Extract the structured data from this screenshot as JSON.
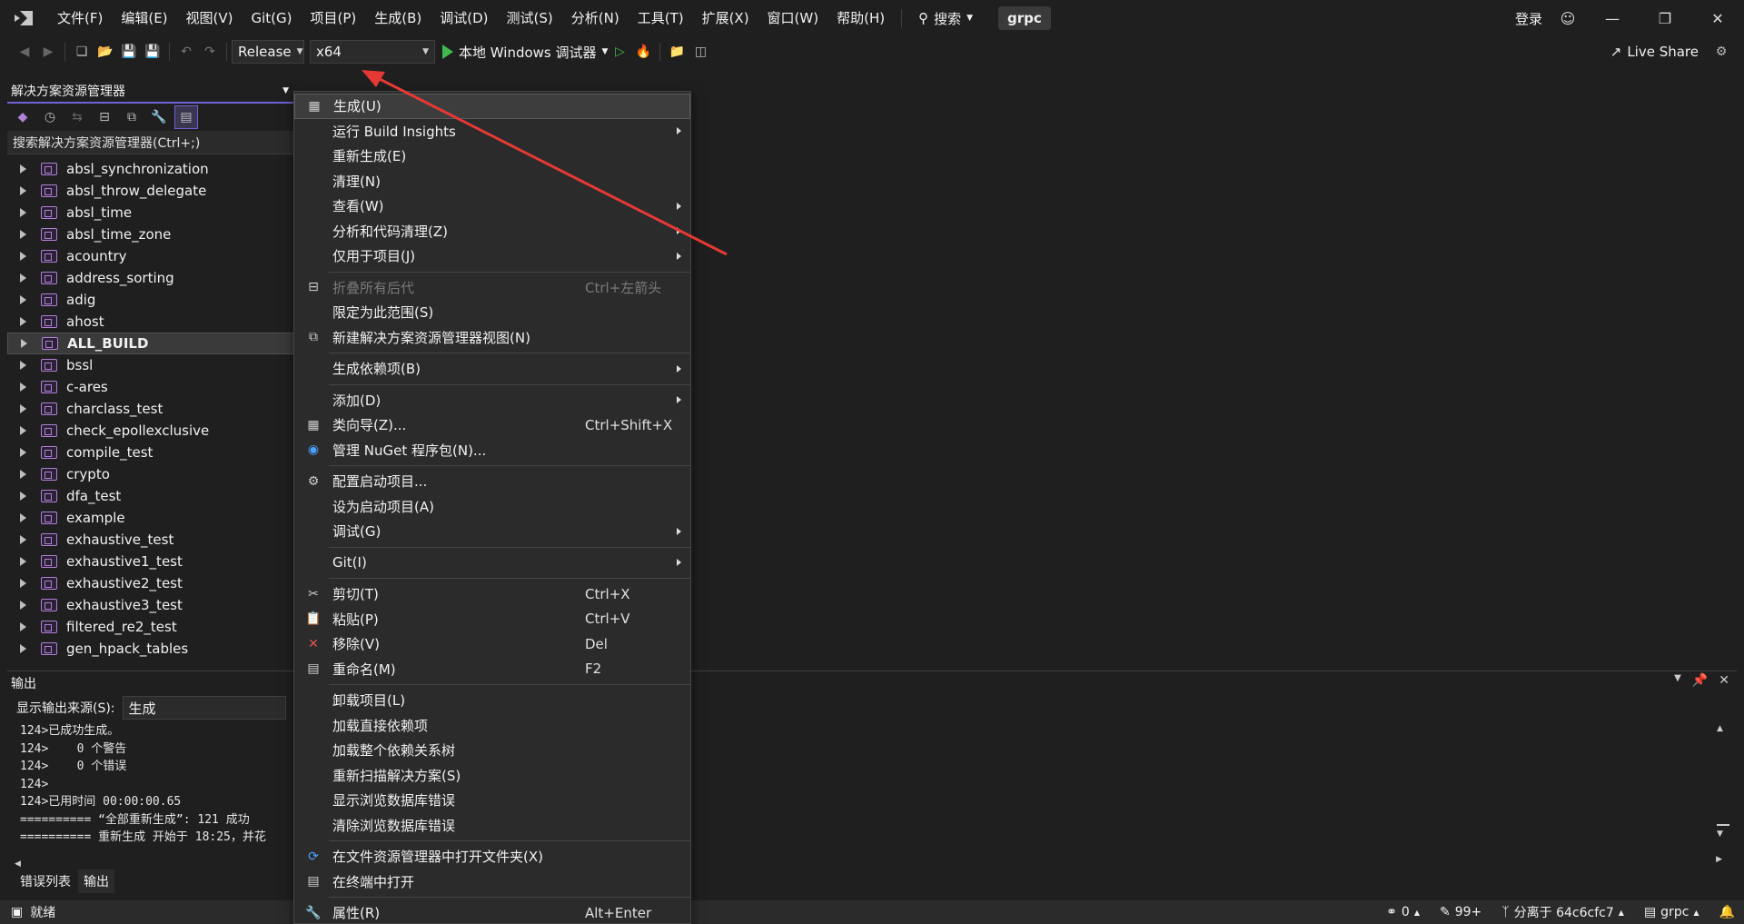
{
  "menubar": {
    "items": [
      "文件(F)",
      "编辑(E)",
      "视图(V)",
      "Git(G)",
      "项目(P)",
      "生成(B)",
      "调试(D)",
      "测试(S)",
      "分析(N)",
      "工具(T)",
      "扩展(X)",
      "窗口(W)",
      "帮助(H)"
    ],
    "search_label": "搜索",
    "project_name": "grpc",
    "login_label": "登录"
  },
  "toolbar": {
    "configuration": "Release",
    "platform": "x64",
    "run_label": "本地 Windows 调试器",
    "live_share": "Live Share"
  },
  "solution_explorer": {
    "title": "解决方案资源管理器",
    "search_placeholder": "搜索解决方案资源管理器(Ctrl+;)",
    "items": [
      "absl_synchronization",
      "absl_throw_delegate",
      "absl_time",
      "absl_time_zone",
      "acountry",
      "address_sorting",
      "adig",
      "ahost",
      "ALL_BUILD",
      "bssl",
      "c-ares",
      "charclass_test",
      "check_epollexclusive",
      "compile_test",
      "crypto",
      "dfa_test",
      "example",
      "exhaustive_test",
      "exhaustive1_test",
      "exhaustive2_test",
      "exhaustive3_test",
      "filtered_re2_test",
      "gen_hpack_tables"
    ],
    "selected": "ALL_BUILD"
  },
  "output": {
    "title": "输出",
    "source_label": "显示输出来源(S):",
    "source_value": "生成",
    "lines": [
      "124>已成功生成。",
      "124>    0 个警告",
      "124>    0 个错误",
      "124>",
      "124>已用时间 00:00:00.65",
      "========== “全部重新生成”: 121 成功",
      "========== 重新生成 开始于 18:25，并花"
    ],
    "tabs": [
      "错误列表",
      "输出"
    ]
  },
  "statusbar": {
    "ready": "就绪",
    "errors": "0",
    "changes": "99+",
    "branch": "分离于 64c6cfc7",
    "repo": "grpc"
  },
  "context_menu": {
    "items": [
      {
        "label": "生成(U)",
        "icon": "build-icon",
        "highlight": true
      },
      {
        "label": "运行 Build Insights",
        "submenu": true
      },
      {
        "label": "重新生成(E)"
      },
      {
        "label": "清理(N)"
      },
      {
        "label": "查看(W)",
        "submenu": true
      },
      {
        "label": "分析和代码清理(Z)",
        "submenu": true
      },
      {
        "label": "仅用于项目(J)",
        "submenu": true
      },
      {
        "sep": true
      },
      {
        "label": "折叠所有后代",
        "shortcut": "Ctrl+左箭头",
        "disabled": true,
        "icon": "collapse-icon"
      },
      {
        "label": "限定为此范围(S)"
      },
      {
        "label": "新建解决方案资源管理器视图(N)",
        "icon": "new-view-icon"
      },
      {
        "sep": true
      },
      {
        "label": "生成依赖项(B)",
        "submenu": true
      },
      {
        "sep": true
      },
      {
        "label": "添加(D)",
        "submenu": true
      },
      {
        "label": "类向导(Z)...",
        "shortcut": "Ctrl+Shift+X",
        "icon": "class-wizard-icon"
      },
      {
        "label": "管理 NuGet 程序包(N)...",
        "icon": "nuget-icon"
      },
      {
        "sep": true
      },
      {
        "label": "配置启动项目...",
        "icon": "gear-icon"
      },
      {
        "label": "设为启动项目(A)"
      },
      {
        "label": "调试(G)",
        "submenu": true
      },
      {
        "sep": true
      },
      {
        "label": "Git(I)",
        "submenu": true
      },
      {
        "sep": true
      },
      {
        "label": "剪切(T)",
        "shortcut": "Ctrl+X",
        "icon": "scissors-icon"
      },
      {
        "label": "粘贴(P)",
        "shortcut": "Ctrl+V",
        "icon": "paste-icon"
      },
      {
        "label": "移除(V)",
        "shortcut": "Del",
        "icon": "remove-icon"
      },
      {
        "label": "重命名(M)",
        "shortcut": "F2",
        "icon": "rename-icon"
      },
      {
        "sep": true
      },
      {
        "label": "卸载项目(L)"
      },
      {
        "label": "加载直接依赖项"
      },
      {
        "label": "加载整个依赖关系树"
      },
      {
        "label": "重新扫描解决方案(S)"
      },
      {
        "label": "显示浏览数据库错误"
      },
      {
        "label": "清除浏览数据库错误"
      },
      {
        "sep": true
      },
      {
        "label": "在文件资源管理器中打开文件夹(X)",
        "icon": "open-folder-icon"
      },
      {
        "label": "在终端中打开",
        "icon": "terminal-icon"
      },
      {
        "sep": true
      },
      {
        "label": "属性(R)",
        "shortcut": "Alt+Enter",
        "icon": "wrench-icon"
      }
    ]
  },
  "colors": {
    "accent": "#6e62d6",
    "arrow": "#e53935",
    "run_green": "#3fb950"
  }
}
